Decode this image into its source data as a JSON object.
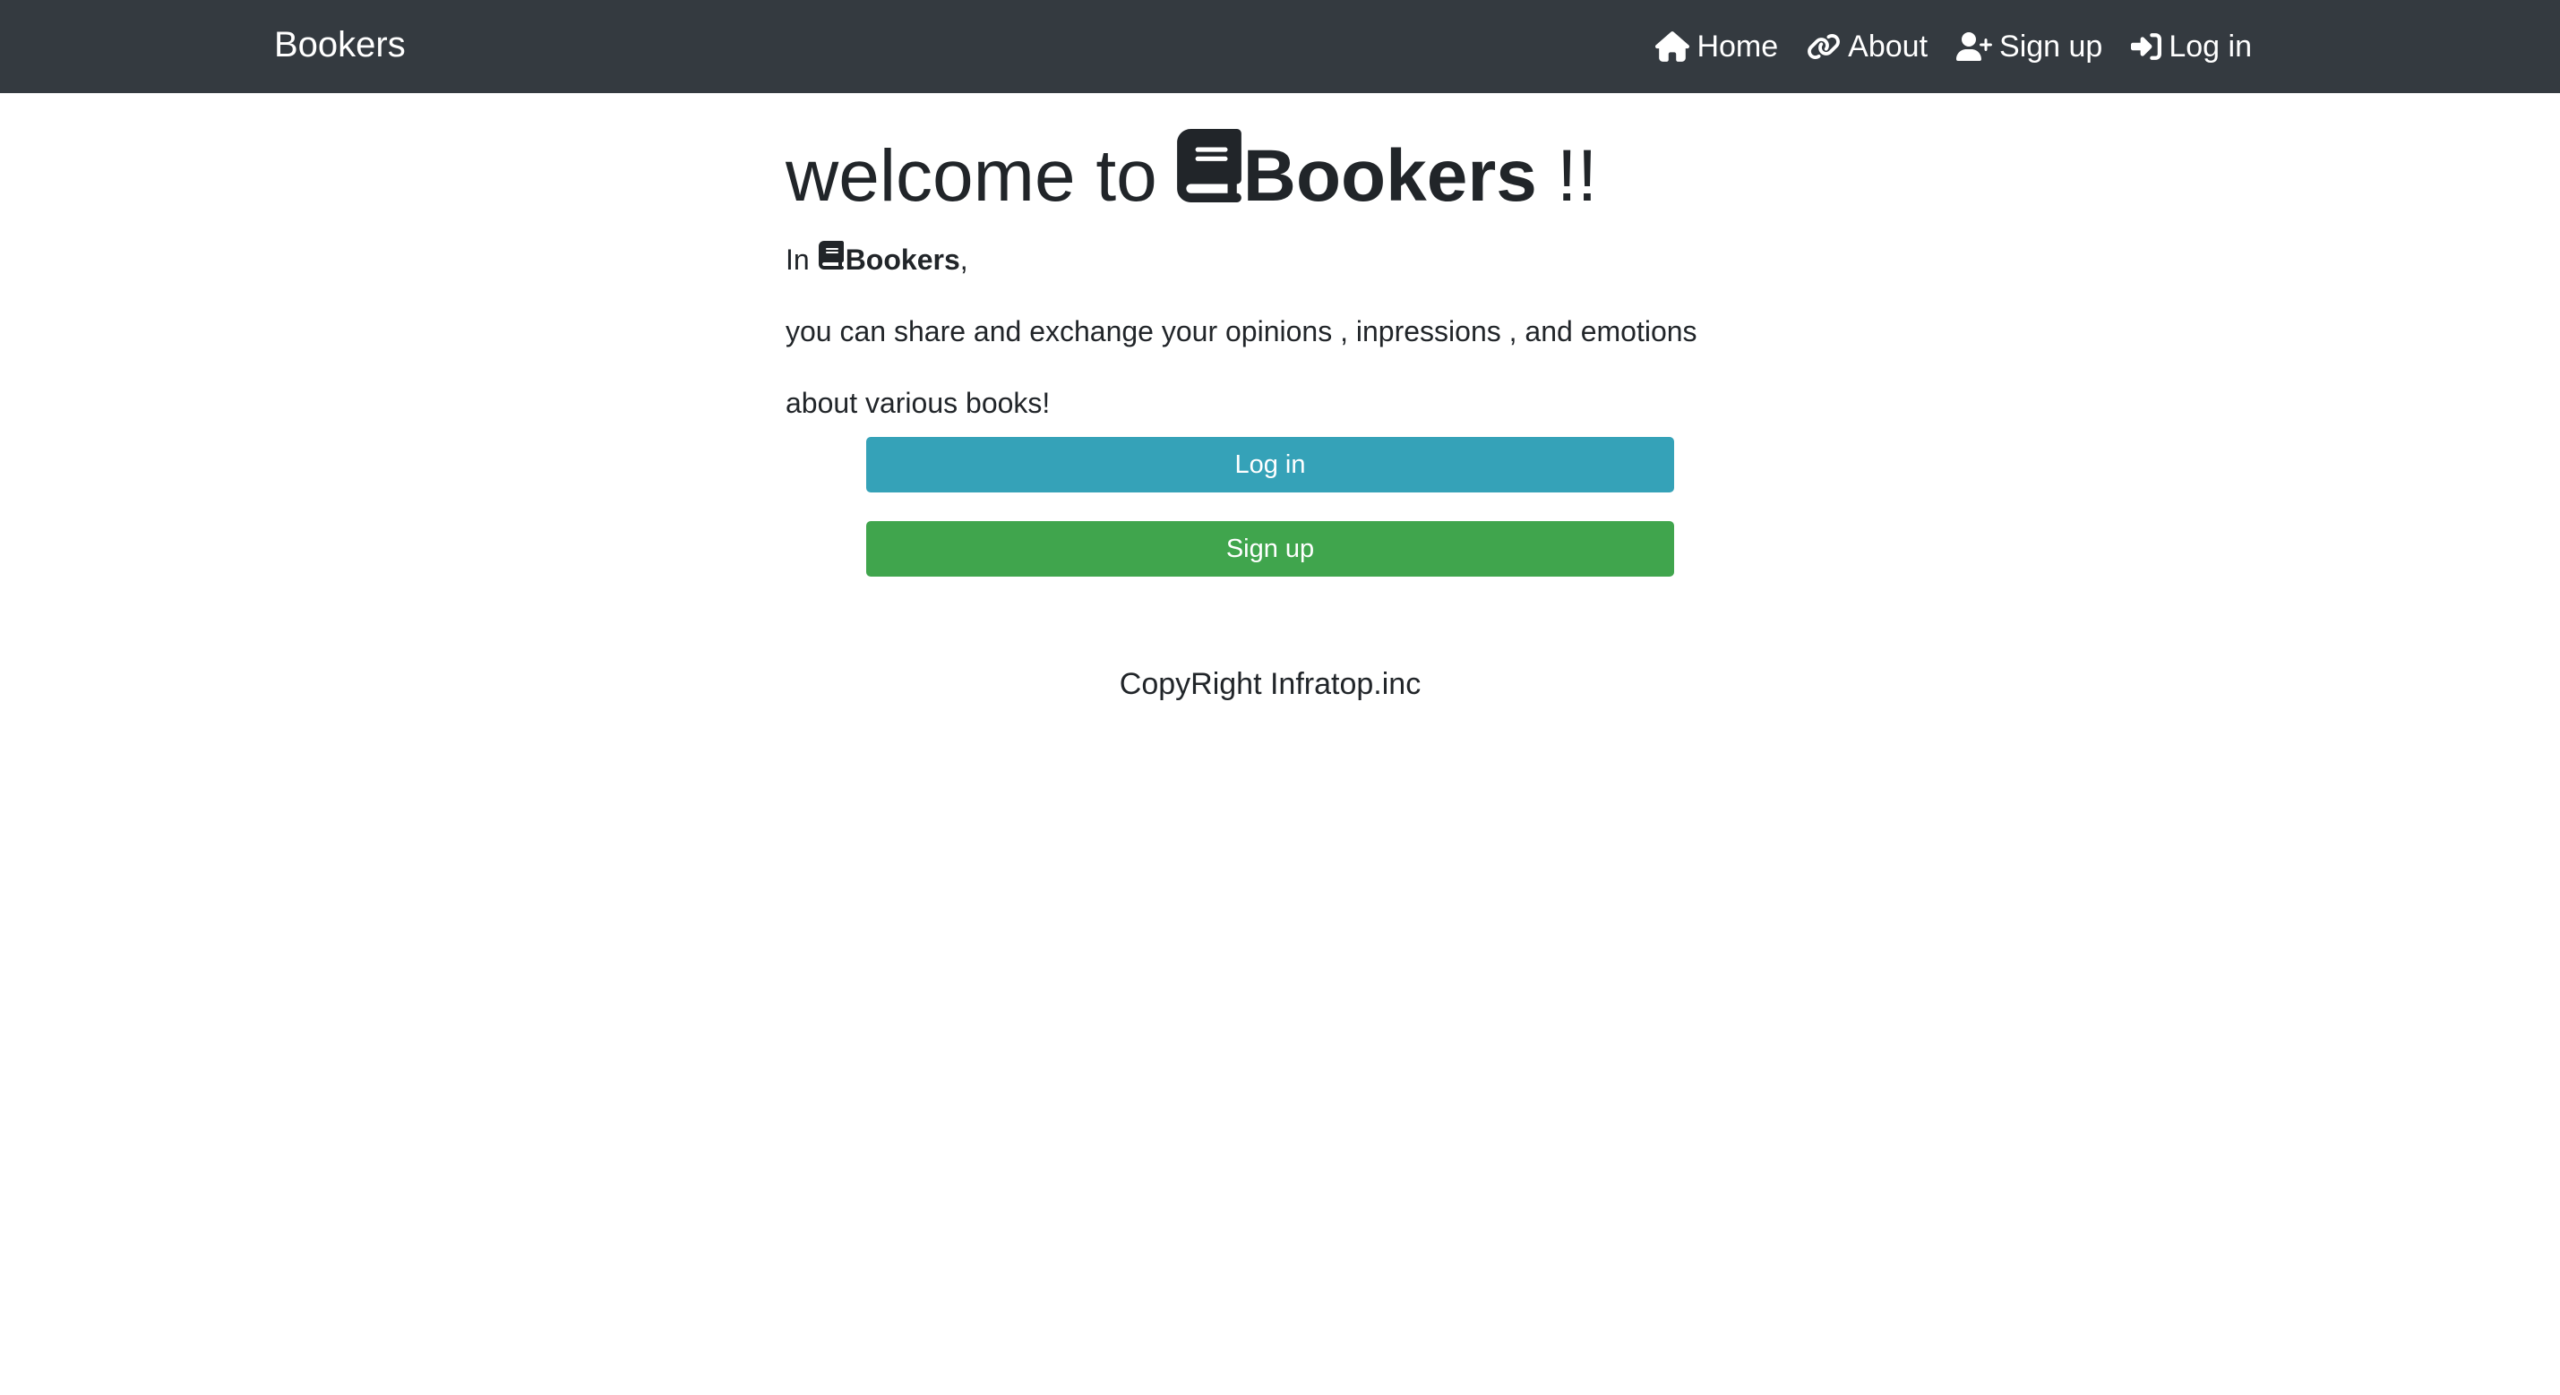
{
  "navbar": {
    "brand": "Bookers",
    "links": [
      {
        "label": "Home",
        "icon": "home-icon"
      },
      {
        "label": "About",
        "icon": "link-icon"
      },
      {
        "label": "Sign up",
        "icon": "user-plus-icon"
      },
      {
        "label": "Log in",
        "icon": "sign-in-icon"
      }
    ],
    "background": "#343a40"
  },
  "main": {
    "title_prefix": "welcome to",
    "title_brand": "Bookers",
    "title_suffix": "!!",
    "intro_prefix": "In",
    "intro_brand": "Bookers",
    "intro_suffix": ",",
    "line1": "you can share and exchange your opinions , inpressions , and emotions",
    "line2": "about various books!",
    "login_button": "Log in",
    "signup_button": "Sign up",
    "login_color": "#35a2b8",
    "signup_color": "#40a54d"
  },
  "footer": {
    "copyright": "CopyRight Infratop.inc"
  }
}
